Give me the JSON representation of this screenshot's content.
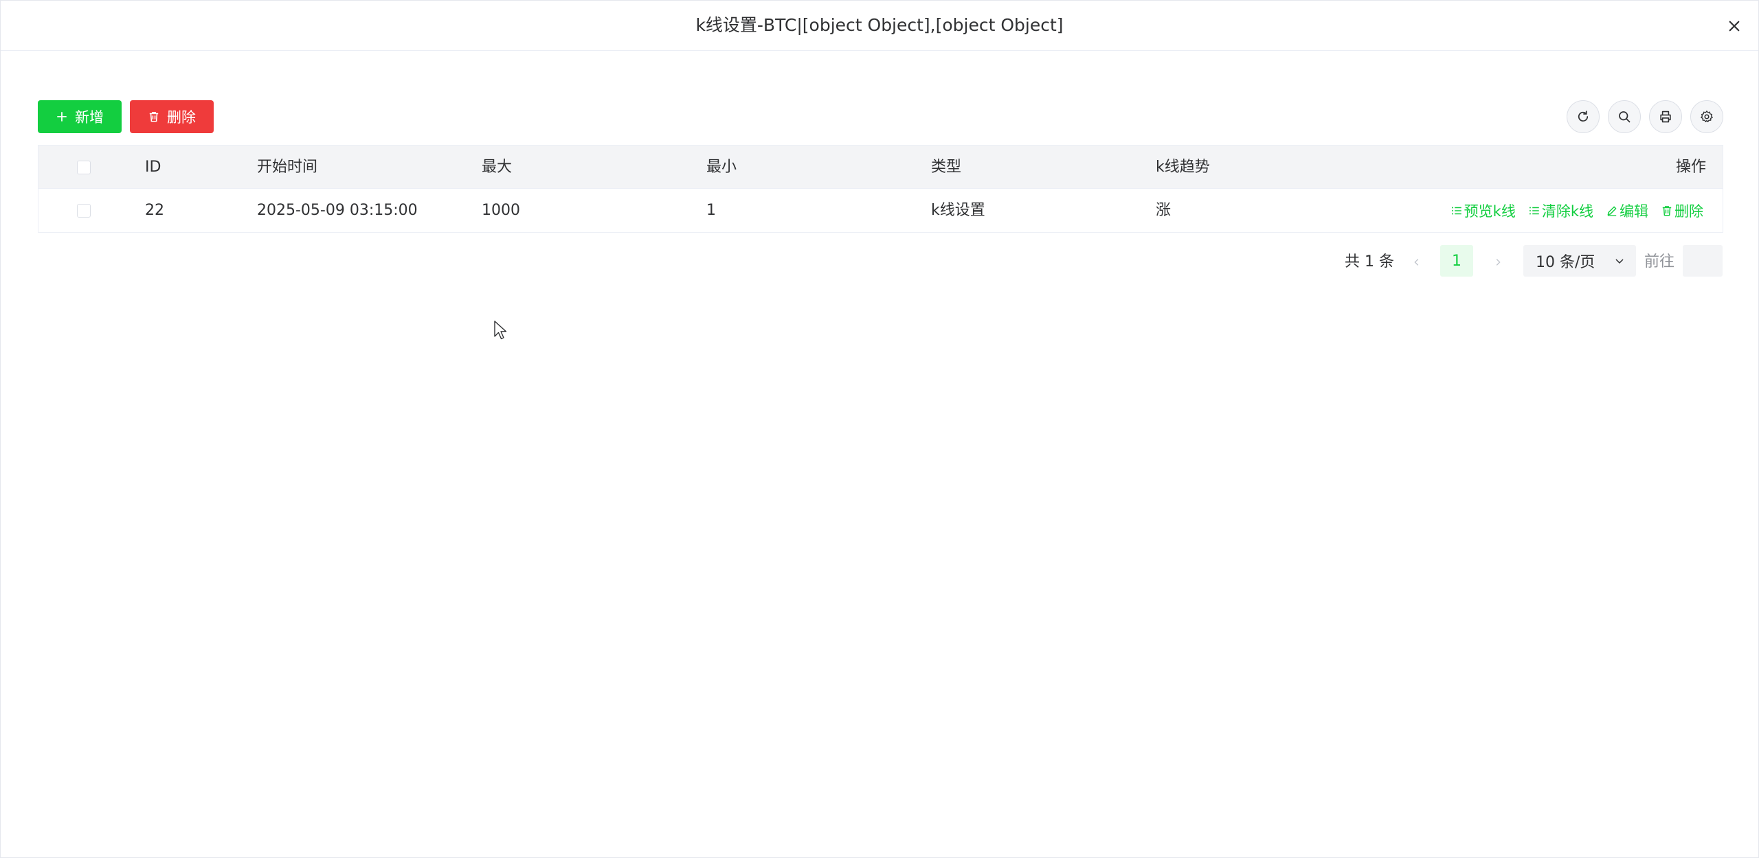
{
  "dialog": {
    "title": "k线设置-BTC|[object Object],[object Object]"
  },
  "toolbar": {
    "add_label": "新增",
    "delete_label": "删除"
  },
  "table": {
    "headers": {
      "id": "ID",
      "start_time": "开始时间",
      "max": "最大",
      "min": "最小",
      "type": "类型",
      "trend": "k线趋势",
      "actions": "操作"
    },
    "rows": [
      {
        "id": "22",
        "start_time": "2025-05-09 03:15:00",
        "max": "1000",
        "min": "1",
        "type": "k线设置",
        "trend": "涨",
        "actions": {
          "preview": "预览k线",
          "clear": "清除k线",
          "edit": "编辑",
          "delete": "删除"
        }
      }
    ]
  },
  "pagination": {
    "total": "共 1 条",
    "current_page": "1",
    "page_size": "10 条/页",
    "goto_label": "前往",
    "goto_value": ""
  },
  "colors": {
    "primary": "#13ce40",
    "danger": "#ef3b3b",
    "header_bg": "#f3f4f6"
  }
}
